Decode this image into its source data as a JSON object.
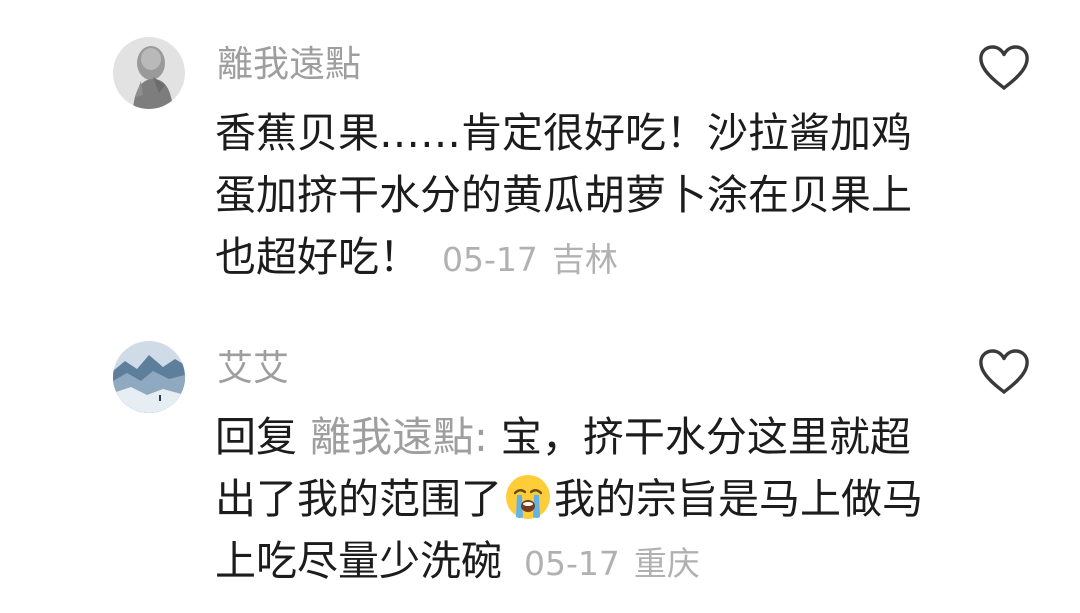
{
  "comments": [
    {
      "username": "離我遠點",
      "text": "香蕉贝果……肯定很好吃！沙拉酱加鸡蛋加挤干水分的黄瓜胡萝卜涂在贝果上也超好吃！",
      "date": "05-17",
      "location": "吉林",
      "avatar_icon": "statue-avatar",
      "like_icon": "heart-outline-icon"
    },
    {
      "username": "艾艾",
      "reply_prefix": "回复",
      "reply_to": "離我遠點:",
      "text_before_emoji": "宝，挤干水分这里就超出了我的范围了",
      "emoji_icon": "loudly-crying-face-emoji",
      "text_after_emoji": "我的宗旨是马上做马上吃尽量少洗碗",
      "date": "05-17",
      "location": "重庆",
      "avatar_icon": "snow-landscape-avatar",
      "like_icon": "heart-outline-icon"
    }
  ],
  "colors": {
    "username": "#9e9e9e",
    "body": "#1c1c1c",
    "meta": "#b1b1b1",
    "icon": "#3a3a3a"
  }
}
